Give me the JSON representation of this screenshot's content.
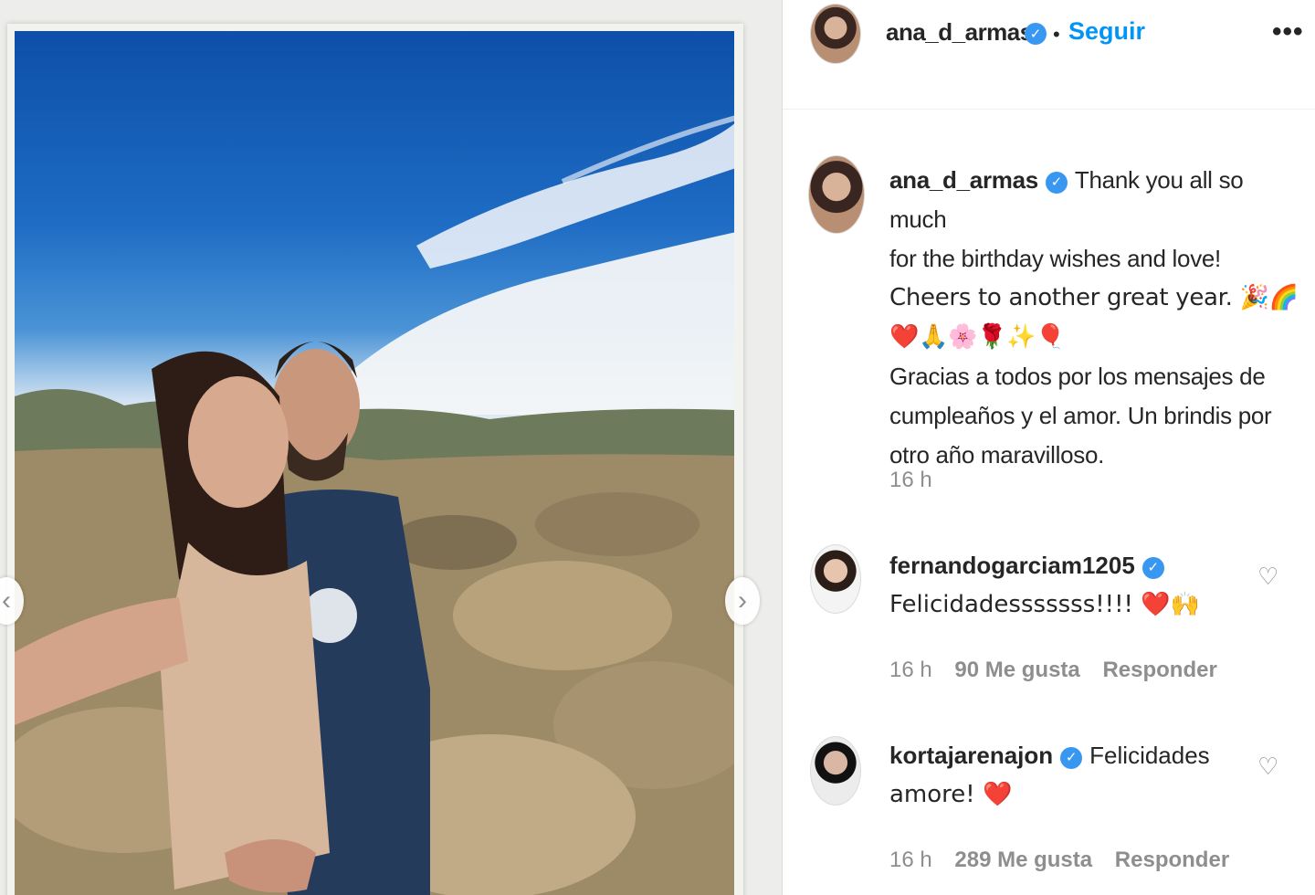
{
  "post": {
    "author": "ana_d_armas",
    "follow_label": "Seguir",
    "separator": "•",
    "more_label": "•••"
  },
  "caption": {
    "author": "ana_d_armas",
    "line1": "Thank you all so much",
    "line2": "for the birthday wishes and love!",
    "line3": "Cheers to another great year. 🎉🌈",
    "line4": "❤️🙏🌸🌹✨🎈",
    "line5": "Gracias a todos por los mensajes de",
    "line6": "cumpleaños y el amor. Un brindis por",
    "line7": "otro año maravilloso.",
    "time": "16 h"
  },
  "comments": [
    {
      "author": "fernandogarciam1205",
      "text": "Felicidadesssssss!!!! ❤️🙌",
      "time": "16 h",
      "likes": "90 Me gusta",
      "reply_label": "Responder"
    },
    {
      "author": "kortajarenajon",
      "text_line1": "Felicidades",
      "text_line2": "amore! ❤️",
      "time": "16 h",
      "likes": "289 Me gusta",
      "reply_label": "Responder"
    }
  ],
  "icons": {
    "verified": "verified-badge-icon",
    "like": "heart-outline-icon",
    "prev": "chevron-left-icon",
    "next": "chevron-right-icon",
    "more": "more-options-icon"
  },
  "colors": {
    "accent": "#0095f6",
    "verified": "#3897f0",
    "muted": "#8e8e8e",
    "text": "#262626"
  }
}
